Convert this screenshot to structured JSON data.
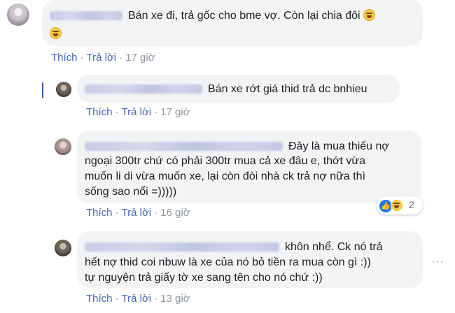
{
  "comments": [
    {
      "text_line1": "Bán xe đi, trả gốc cho bme vợ. Còn lại chia đôi",
      "like_label": "Thích",
      "reply_label": "Trả lời",
      "time": "17 giờ",
      "emoji": [
        "grinning-squint-icon",
        "grinning-squint-icon"
      ]
    },
    {
      "text_line1": "Bán xe rớt giá thid trả dc bnhieu",
      "like_label": "Thích",
      "reply_label": "Trả lời",
      "time": "17 giờ"
    },
    {
      "text_line1": "Đây là mua thiếu nợ",
      "text_line2": "ngoại 300tr chứ có phải 300tr mua cả xe đâu e, thớt vừa",
      "text_line3": "muốn li di vừa muốn xe, lại còn đòi nhà ck trả nợ nữa thì",
      "text_line4": "sống sao nổi =)))))",
      "like_label": "Thích",
      "reply_label": "Trả lời",
      "time": "16 giờ",
      "reactions": {
        "count": "2",
        "icons": [
          "like-icon",
          "haha-icon"
        ],
        "like_color": "#1877f2"
      }
    },
    {
      "text_line1": "khôn nhể. Ck nó trả",
      "text_line2": "hết nợ thid coi nbuw là xe của nó bỏ tiền ra mua còn gì :))",
      "text_line3": "tự nguyện trả giấy tờ xe sang tên cho nó chứ :))",
      "like_label": "Thích",
      "reply_label": "Trả lời",
      "time": "13 giờ"
    }
  ],
  "separator": "·",
  "more_icon": "···",
  "colors": {
    "link": "#4267b2",
    "bubble": "#f2f3f5",
    "meta": "#8d949e"
  }
}
